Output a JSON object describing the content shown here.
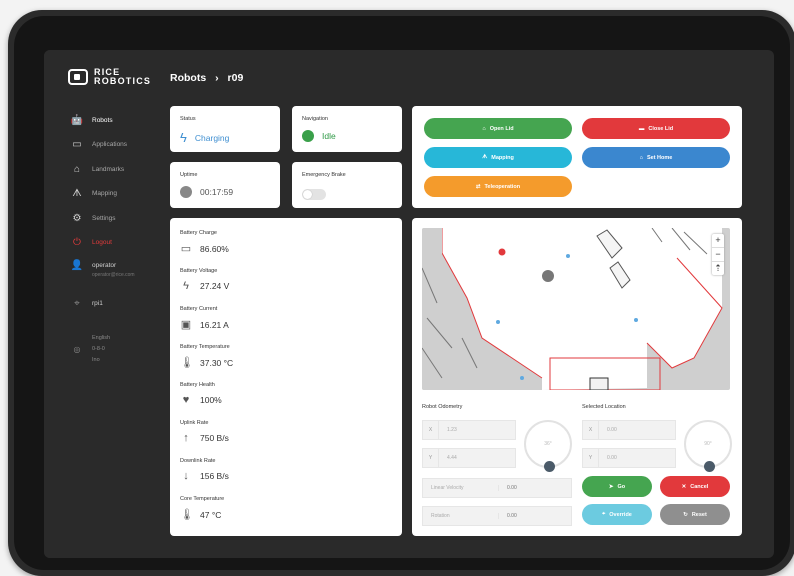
{
  "brand": {
    "line1": "RICE",
    "line2": "ROBOTICS"
  },
  "breadcrumb": {
    "root": "Robots",
    "separator": "›",
    "current": "r09"
  },
  "sidebar": {
    "items": [
      {
        "label": "Robots",
        "icon": "robot-icon",
        "glyph": "🤖"
      },
      {
        "label": "Applications",
        "icon": "monitor-icon",
        "glyph": "▭"
      },
      {
        "label": "Landmarks",
        "icon": "landmark-icon",
        "glyph": "⌂"
      },
      {
        "label": "Mapping",
        "icon": "mapping-icon",
        "glyph": "ᗑ"
      },
      {
        "label": "Settings",
        "icon": "settings-icon",
        "glyph": "⚙"
      },
      {
        "label": "Logout",
        "icon": "logout-icon",
        "glyph": "⏻"
      }
    ],
    "user": {
      "name": "operator",
      "sub": "operator@rice.com"
    },
    "site": {
      "label": "rpi1"
    },
    "language": {
      "line1": "English",
      "line2": "0-8-0",
      "line3": "Ino"
    }
  },
  "status": {
    "label": "Status",
    "value": "Charging"
  },
  "navigation": {
    "label": "Navigation",
    "value": "Idle"
  },
  "uptime": {
    "label": "Uptime",
    "value": "00:17:59"
  },
  "estop": {
    "label": "Emergency Brake"
  },
  "actions": {
    "open_lid": "Open Lid",
    "close_lid": "Close Lid",
    "mapping": "Mapping",
    "set_home": "Set Home",
    "teleoperation": "Teleoperation",
    "go": "Go",
    "cancel": "Cancel",
    "override": "Override",
    "reset": "Reset"
  },
  "battery": [
    {
      "label": "Battery Charge",
      "value": "86.60%",
      "icon": "battery-icon",
      "glyph": "▭"
    },
    {
      "label": "Battery Voltage",
      "value": "27.24 V",
      "icon": "lightning-icon",
      "glyph": "ϟ"
    },
    {
      "label": "Battery Current",
      "value": "16.21 A",
      "icon": "car-battery-icon",
      "glyph": "▣"
    },
    {
      "label": "Battery Temperature",
      "value": "37.30 °C",
      "icon": "thermometer-icon",
      "glyph": "🌡"
    },
    {
      "label": "Battery Health",
      "value": "100%",
      "icon": "heartbeat-icon",
      "glyph": "♥"
    },
    {
      "label": "Uplink Rate",
      "value": "750 B/s",
      "icon": "arrow-up-icon",
      "glyph": "↑"
    },
    {
      "label": "Downlink Rate",
      "value": "156 B/s",
      "icon": "arrow-down-icon",
      "glyph": "↓"
    },
    {
      "label": "Core Temperature",
      "value": "47 °C",
      "icon": "thermometer-icon",
      "glyph": "🌡"
    }
  ],
  "odometry": {
    "label": "Robot Odometry",
    "x": {
      "prefix": "X",
      "value": "1.23"
    },
    "y": {
      "prefix": "Y",
      "value": "4.44"
    },
    "dial": "36°",
    "linear_label": "Linear Velocity",
    "linear_value": "0.00",
    "rotation_label": "Rotation",
    "rotation_value": "0.00"
  },
  "selected": {
    "label": "Selected Location",
    "x": {
      "prefix": "X",
      "value": "0.00"
    },
    "y": {
      "prefix": "Y",
      "value": "0.00"
    },
    "dial": "90°"
  },
  "map": {
    "zoom_in": "+",
    "zoom_out": "−",
    "north": "⇡"
  },
  "colors": {
    "charging": "#3f8fd1",
    "idle": "#2f9a47",
    "marker": "#e2393c"
  }
}
